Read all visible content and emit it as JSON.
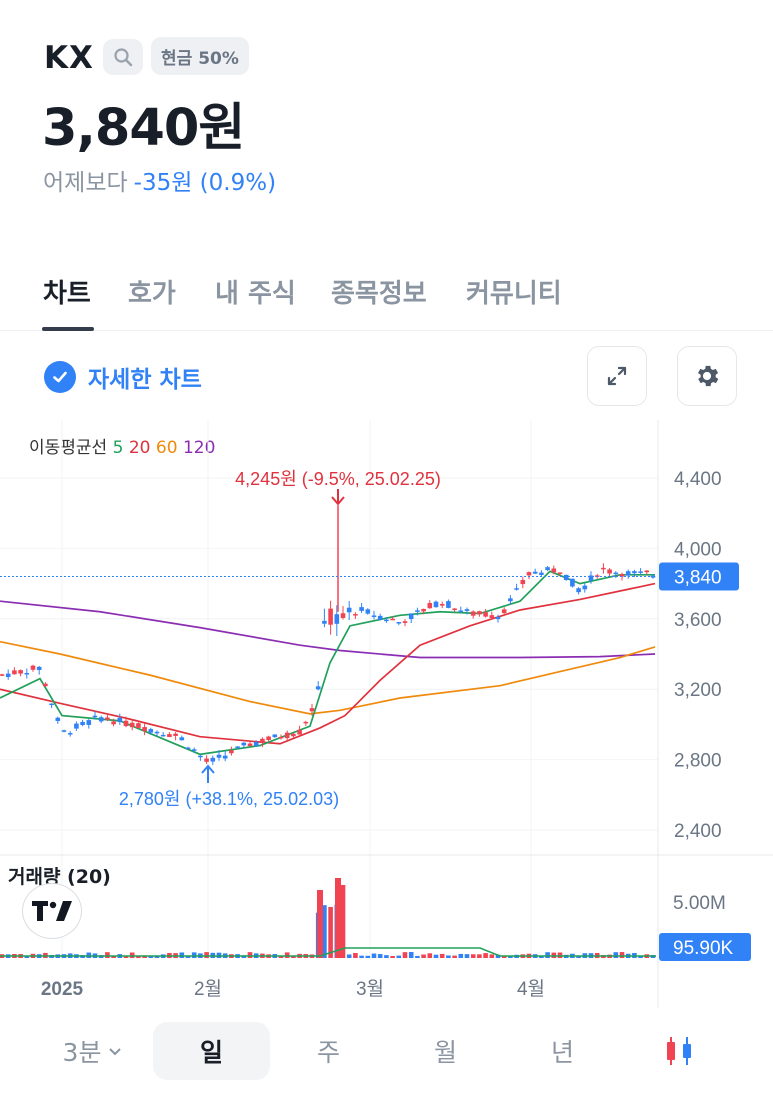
{
  "header": {
    "title": "KX",
    "cash_badge": "현금 50%",
    "price": "3,840원",
    "change_label": "어제보다",
    "change_value": "-35원 (0.9%)",
    "change_color": "#3182f6"
  },
  "tabs": [
    "차트",
    "호가",
    "내 주식",
    "종목정보",
    "커뮤니티"
  ],
  "detail_toggle": {
    "label": "자세한 차트",
    "checked": true
  },
  "buttons": {
    "expand_icon": "expand-icon",
    "settings_icon": "gear-icon"
  },
  "ma_legend": {
    "label": "이동평균선",
    "periods": [
      {
        "value": "5",
        "color": "#20a05a"
      },
      {
        "value": "20",
        "color": "#e0323e"
      },
      {
        "value": "60",
        "color": "#f08a0c"
      },
      {
        "value": "120",
        "color": "#8b2db3"
      }
    ]
  },
  "chart_data": {
    "type": "candlestick",
    "x_ticks": [
      "2025",
      "2월",
      "3월",
      "4월"
    ],
    "y_ticks": [
      "4,400",
      "4,000",
      "3,600",
      "3,200",
      "2,800",
      "2,400"
    ],
    "ylim": [
      2300,
      4500
    ],
    "current_price_label": "3,840",
    "current_price": 3840,
    "high_annotation": "4,245원 (-9.5%, 25.02.25)",
    "low_annotation": "2,780원 (+38.1%, 25.02.03)",
    "volume_label": "거래량 (20)",
    "volume_tick": "5.00M",
    "current_volume_label": "95.90K",
    "up_color": "#f04452",
    "down_color": "#3182f6"
  },
  "periods": {
    "selector": "3분",
    "items": [
      "일",
      "주",
      "월",
      "년"
    ],
    "active": "일"
  }
}
